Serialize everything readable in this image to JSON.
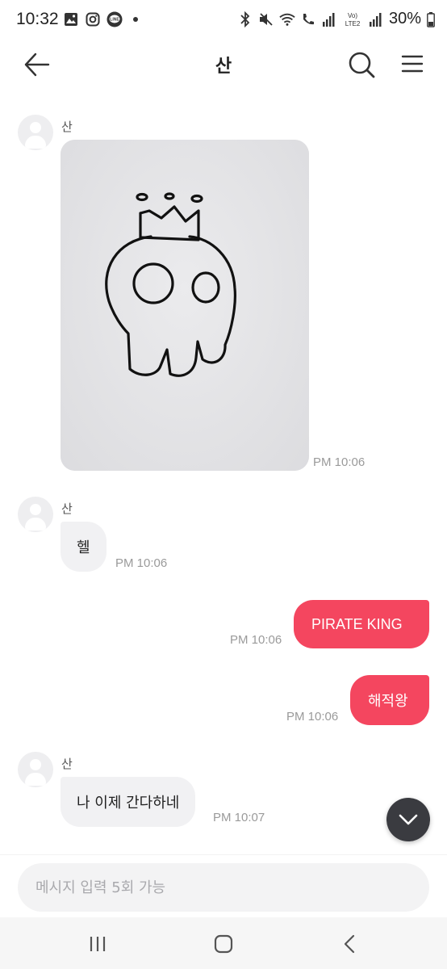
{
  "status_bar": {
    "time": "10:32",
    "battery": "30%",
    "left_icons": [
      "gallery-icon",
      "instagram-icon",
      "line-icon"
    ],
    "right_icons": [
      "bluetooth-icon",
      "mute-icon",
      "wifi-icon",
      "call-icon",
      "signal-icon",
      "volte-icon",
      "battery-icon"
    ],
    "volte_label": "Vo) LTE2"
  },
  "header": {
    "title": "산"
  },
  "messages": [
    {
      "type": "incoming-image",
      "sender": "산",
      "time": "PM 10:06"
    },
    {
      "type": "incoming",
      "sender": "산",
      "text": "헬",
      "time": "PM 10:06"
    },
    {
      "type": "outgoing",
      "text": "PIRATE KING",
      "time": "PM 10:06"
    },
    {
      "type": "outgoing",
      "text": "해적왕",
      "time": "PM 10:06"
    },
    {
      "type": "incoming",
      "sender": "산",
      "text": "나 이제 간다하네",
      "time": "PM 10:07"
    }
  ],
  "composer": {
    "placeholder": "메시지 입력 5회 가능"
  },
  "colors": {
    "accent": "#f4465f",
    "incoming_bubble": "#f1f1f3",
    "scroll_button": "#3a3b40"
  }
}
